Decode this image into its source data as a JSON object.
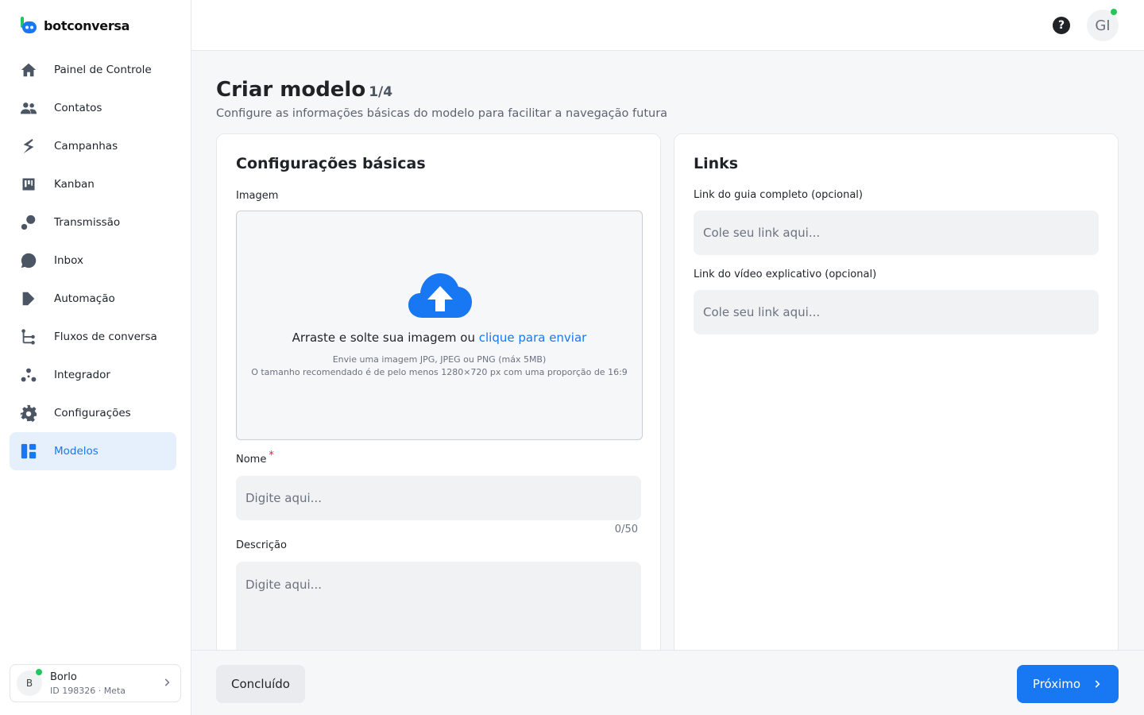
{
  "brand": {
    "name": "botconversa",
    "accent": "#1877f2"
  },
  "sidebar": {
    "items": [
      {
        "label": "Painel de Controle",
        "icon": "home-icon"
      },
      {
        "label": "Contatos",
        "icon": "users-icon"
      },
      {
        "label": "Campanhas",
        "icon": "campaign-icon"
      },
      {
        "label": "Kanban",
        "icon": "kanban-icon"
      },
      {
        "label": "Transmissão",
        "icon": "broadcast-icon"
      },
      {
        "label": "Inbox",
        "icon": "chat-icon"
      },
      {
        "label": "Automação",
        "icon": "automation-icon"
      },
      {
        "label": "Fluxos de conversa",
        "icon": "flow-icon"
      },
      {
        "label": "Integrador",
        "icon": "integration-icon"
      },
      {
        "label": "Configurações",
        "icon": "gear-icon"
      },
      {
        "label": "Modelos",
        "icon": "templates-icon",
        "active": true
      }
    ]
  },
  "account": {
    "initial": "B",
    "name": "Borlo",
    "id_line": "ID 198326 · Meta"
  },
  "topbar": {
    "help_glyph": "?",
    "user_initials": "GI"
  },
  "page": {
    "title": "Criar modelo",
    "step": "1/4",
    "subtitle": "Configure as informações básicas do modelo para facilitar a navegação futura"
  },
  "basic": {
    "title": "Configurações básicas",
    "image_label": "Imagem",
    "dropzone": {
      "main_text": "Arraste e solte sua imagem ou ",
      "link_text": "clique para enviar",
      "hint1": "Envie uma imagem JPG, JPEG ou PNG (máx 5MB)",
      "hint2": "O tamanho recomendado é de pelo menos 1280×720 px com uma proporção de 16:9"
    },
    "name_label": "Nome",
    "required_mark": "*",
    "name_placeholder": "Digite aqui...",
    "name_value": "",
    "name_counter": "0/50",
    "description_label": "Descrição",
    "description_placeholder": "Digite aqui...",
    "description_value": ""
  },
  "links": {
    "title": "Links",
    "guide_label": "Link do guia completo (opcional)",
    "guide_placeholder": "Cole seu link aqui...",
    "guide_value": "",
    "video_label": "Link do vídeo explicativo (opcional)",
    "video_placeholder": "Cole seu link aqui...",
    "video_value": ""
  },
  "footer": {
    "done_label": "Concluído",
    "next_label": "Próximo"
  }
}
